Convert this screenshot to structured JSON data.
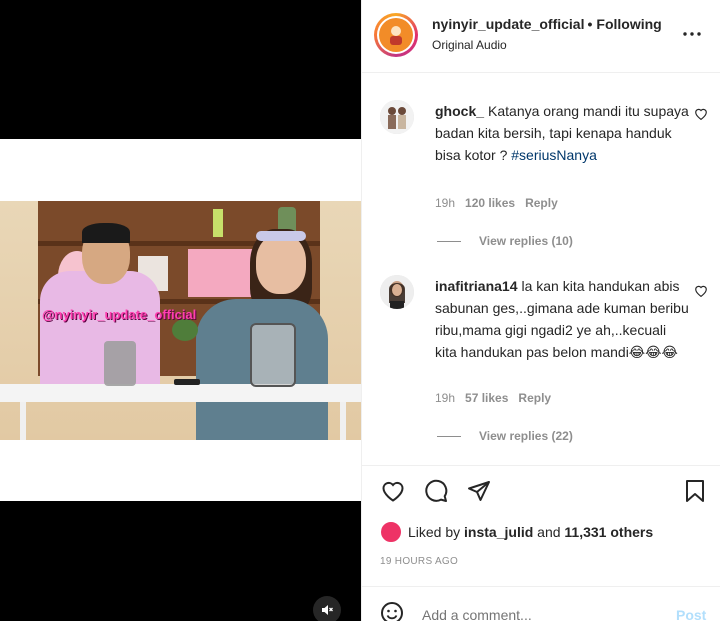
{
  "media": {
    "watermark": "@nyinyir_update_official",
    "mute_icon": "muted-speaker-icon"
  },
  "header": {
    "username": "nyinyir_update_official",
    "separator": "•",
    "follow_status": "Following",
    "subtitle": "Original Audio",
    "more_icon": "more-options-icon"
  },
  "comments": [
    {
      "user": "ghock_",
      "text": "Katanya orang mandi itu supaya badan kita bersih, tapi kenapa handuk bisa kotor ?",
      "tag": "#seriusNanya",
      "time": "19h",
      "likes": "120 likes",
      "reply": "Reply",
      "view_replies": "View replies (10)"
    },
    {
      "user": "inafitriana14",
      "text": "la kan kita handukan abis sabunan ges,..gimana ade kuman beribu ribu,mama gigi ngadi2 ye ah,..kecuali kita handukan pas belon mandi😂😂😂",
      "tag": "",
      "time": "19h",
      "likes": "57 likes",
      "reply": "Reply",
      "view_replies": "View replies (22)"
    }
  ],
  "actions": {
    "like_icon": "heart-icon",
    "comment_icon": "comment-icon",
    "share_icon": "share-icon",
    "save_icon": "bookmark-icon"
  },
  "likes": {
    "prefix": "Liked by",
    "user": "insta_julid",
    "middle": "and",
    "others": "11,331 others"
  },
  "timestamp": "19 HOURS AGO",
  "add_comment": {
    "placeholder": "Add a comment...",
    "post_label": "Post"
  },
  "colors": {
    "text": "#262626",
    "muted": "#8e8e8e",
    "hashtag": "#00376b",
    "post_disabled": "#b2dffc",
    "watermark": "#ff3fb0"
  }
}
